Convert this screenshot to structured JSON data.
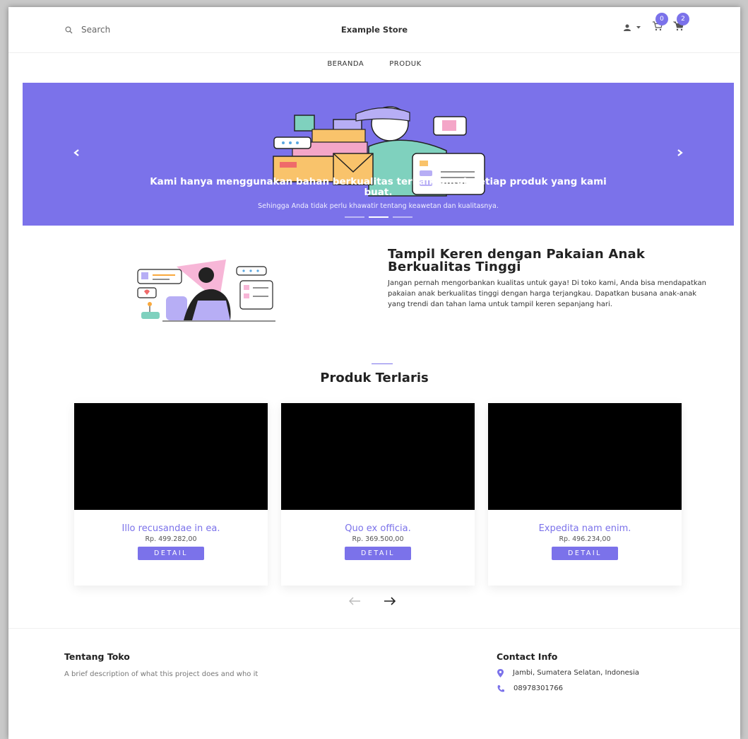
{
  "colors": {
    "accent": "#7b72ea",
    "background": "#ffffff"
  },
  "header": {
    "search_placeholder": "Search",
    "brand": "Example Store",
    "user_icon": "user-icon",
    "wishlist_icon": "cart-outline-icon",
    "wishlist_count": "0",
    "cart_icon": "cart-icon",
    "cart_count": "2"
  },
  "nav": {
    "items": [
      {
        "label": "BERANDA"
      },
      {
        "label": "PRODUK"
      }
    ]
  },
  "hero": {
    "title": "Kami hanya menggunakan bahan berkualitas terbaik untuk setiap produk yang kami buat.",
    "subtitle": "Sehingga Anda tidak perlu khawatir tentang keawetan dan kualitasnya.",
    "prev_icon": "chevron-left-icon",
    "next_icon": "chevron-right-icon",
    "slides": 3,
    "active_slide": 2
  },
  "about": {
    "title": "Tampil Keren dengan Pakaian Anak Berkualitas Tinggi",
    "body": "Jangan pernah mengorbankan kualitas untuk gaya! Di toko kami, Anda bisa mendapatkan pakaian anak berkualitas tinggi dengan harga terjangkau. Dapatkan busana anak-anak yang trendi dan tahan lama untuk tampil keren sepanjang hari."
  },
  "products": {
    "title": "Produk Terlaris",
    "detail_label": "DETAIL",
    "items": [
      {
        "name": "Illo recusandae in ea.",
        "price": "Rp. 499.282,00"
      },
      {
        "name": "Quo ex officia.",
        "price": "Rp. 369.500,00"
      },
      {
        "name": "Expedita nam enim.",
        "price": "Rp. 496.234,00"
      }
    ],
    "prev_icon": "arrow-left-icon",
    "next_icon": "arrow-right-icon"
  },
  "footer": {
    "about_title": "Tentang Toko",
    "about_desc": "A brief description of what this project does and who it",
    "contact_title": "Contact Info",
    "address": "Jambi, Sumatera Selatan, Indonesia",
    "phone": "08978301766"
  }
}
